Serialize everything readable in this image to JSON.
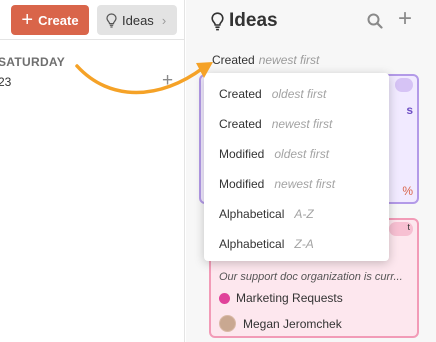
{
  "toolbar": {
    "create_label": "Create",
    "ideas_label": "Ideas"
  },
  "calendar": {
    "day_name": "SATURDAY",
    "day_number": "23"
  },
  "ideas_panel": {
    "title": "Ideas",
    "sort": {
      "field": "Created",
      "direction": "newest first"
    },
    "cards": [
      {
        "description": "Our support doc organization is curr...",
        "tag": "Marketing Requests",
        "person": "Megan Jeromchek"
      }
    ]
  },
  "sort_menu": {
    "options": [
      {
        "field": "Created",
        "direction": "oldest first"
      },
      {
        "field": "Created",
        "direction": "newest first"
      },
      {
        "field": "Modified",
        "direction": "oldest first"
      },
      {
        "field": "Modified",
        "direction": "newest first"
      },
      {
        "field": "Alphabetical",
        "direction": "A-Z"
      },
      {
        "field": "Alphabetical",
        "direction": "Z-A"
      }
    ]
  },
  "colors": {
    "create_button": "#d9654a",
    "annotation_arrow": "#f5a227",
    "card_purple_border": "#b39ae8",
    "card_pink_border": "#f29bb7",
    "tag_dot": "#e0429a"
  },
  "icons": {
    "create": "plus-icon",
    "ideas": "lightbulb-icon",
    "ideas_chevron": "chevron-right-icon",
    "search": "search-icon",
    "add": "plus-icon",
    "add_day": "plus-icon"
  }
}
